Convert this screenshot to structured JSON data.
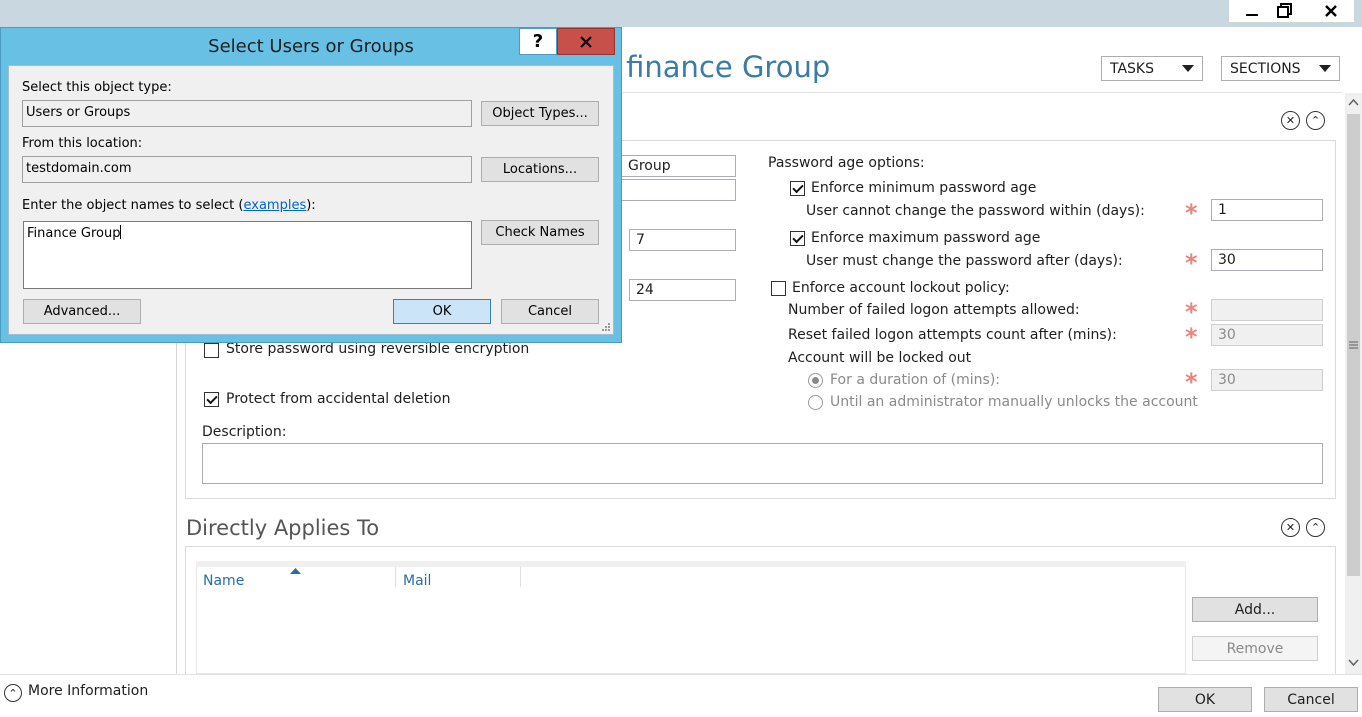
{
  "window": {
    "minimize_icon": "minimize-icon",
    "restore_icon": "restore-icon",
    "close_icon": "close-icon"
  },
  "header": {
    "title": "r finance Group",
    "tasks_label": "TASKS",
    "sections_label": "SECTIONS"
  },
  "password_section": {
    "name_value": "Group",
    "field2_value": "",
    "field3_value": "7",
    "field4_value": "24",
    "store_reversible_label": "Store password using reversible encryption",
    "protect_deletion_label": "Protect from accidental deletion",
    "description_label": "Description:",
    "description_value": "",
    "age_options_label": "Password age options:",
    "enforce_min_label": "Enforce minimum password age",
    "min_days_label": "User cannot change the password within (days):",
    "min_days_value": "1",
    "enforce_max_label": "Enforce maximum password age",
    "max_days_label": "User must change the password after (days):",
    "max_days_value": "30",
    "lockout_label": "Enforce account lockout policy:",
    "failed_attempts_label": "Number of failed logon attempts allowed:",
    "failed_attempts_value": "",
    "reset_label": "Reset failed logon attempts count after (mins):",
    "reset_value": "30",
    "locked_out_label": "Account will be locked out",
    "duration_label": "For a duration of (mins):",
    "duration_value": "30",
    "until_admin_label": "Until an administrator manually unlocks the account",
    "required_star": "*"
  },
  "applies_section": {
    "title": "Directly Applies To",
    "col_name": "Name",
    "col_mail": "Mail",
    "add_label": "Add...",
    "remove_label": "Remove"
  },
  "footer": {
    "more_info_label": "More Information",
    "ok_label": "OK",
    "cancel_label": "Cancel"
  },
  "dialog": {
    "title": "Select Users or Groups",
    "help_label": "?",
    "object_type_label": "Select this object type:",
    "object_type_value": "Users or Groups",
    "object_types_button": "Object Types...",
    "location_label": "From this location:",
    "location_value": "testdomain.com",
    "locations_button": "Locations...",
    "enter_names_prefix": "Enter the object names to select (",
    "examples_link": "examples",
    "enter_names_suffix": "):",
    "names_value": "Finance Group",
    "check_names_button": "Check Names",
    "advanced_button": "Advanced...",
    "ok_button": "OK",
    "cancel_button": "Cancel"
  },
  "colors": {
    "accent_title": "#3b7ca6",
    "dialog_frame": "#68c1e4",
    "close_red": "#c7504b",
    "required_star": "#e8857e"
  }
}
